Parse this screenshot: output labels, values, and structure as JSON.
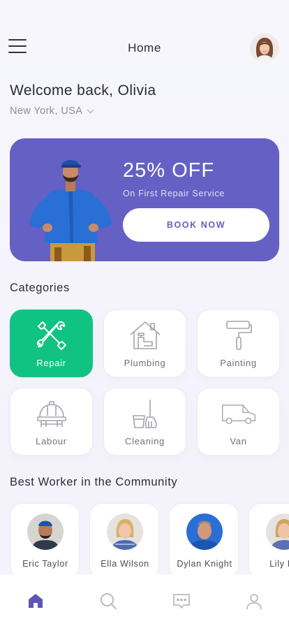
{
  "header": {
    "title": "Home",
    "menu_icon": "hamburger-menu-icon",
    "avatar": "user-avatar"
  },
  "welcome": {
    "greeting": "Welcome back, Olivia",
    "location": "New York, USA"
  },
  "promo": {
    "title": "25% OFF",
    "subtitle": "On First Repair Service",
    "button_label": "BOOK NOW",
    "background_color": "#6460c4"
  },
  "categories": {
    "title": "Categories",
    "items": [
      {
        "label": "Repair",
        "icon": "wrench-screwdriver-icon",
        "active": true
      },
      {
        "label": "Plumbing",
        "icon": "house-pipe-icon",
        "active": false
      },
      {
        "label": "Painting",
        "icon": "paint-roller-icon",
        "active": false
      },
      {
        "label": "Labour",
        "icon": "hard-hat-icon",
        "active": false
      },
      {
        "label": "Cleaning",
        "icon": "broom-bucket-icon",
        "active": false
      },
      {
        "label": "Van",
        "icon": "van-icon",
        "active": false
      }
    ],
    "active_color": "#11c383"
  },
  "workers": {
    "title": "Best Worker in the Community",
    "items": [
      {
        "name": "Eric Taylor"
      },
      {
        "name": "Ella Wilson"
      },
      {
        "name": "Dylan Knight"
      },
      {
        "name": "Lily Ev"
      }
    ]
  },
  "bottom_nav": {
    "items": [
      {
        "icon": "home-icon",
        "active": true
      },
      {
        "icon": "search-icon",
        "active": false
      },
      {
        "icon": "chat-icon",
        "active": false
      },
      {
        "icon": "profile-icon",
        "active": false
      }
    ],
    "active_color": "#5b56b8"
  }
}
